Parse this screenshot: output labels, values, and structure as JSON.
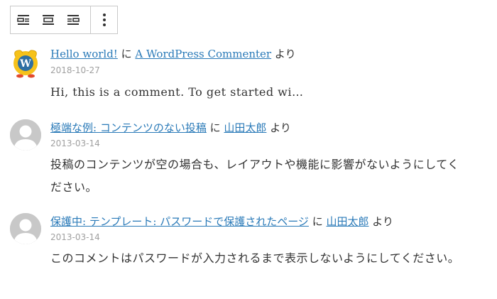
{
  "toolbar": {
    "buttons": [
      {
        "icon": "align-left-icon"
      },
      {
        "icon": "align-center-icon"
      },
      {
        "icon": "align-right-icon"
      }
    ],
    "more_icon": "more-vertical-icon"
  },
  "comments": [
    {
      "post_title": "Hello world!",
      "joiner": "に",
      "author": "A WordPress Commenter",
      "suffix": "より",
      "date": "2018-10-27",
      "excerpt": "Hi, this is a comment. To get started wi…"
    },
    {
      "post_title": "極端な例: コンテンツのない投稿",
      "joiner": "に",
      "author": "山田太郎",
      "suffix": "より",
      "date": "2013-03-14",
      "excerpt": "投稿のコンテンツが空の場合も、レイアウトや機能に影響がないようにしてください。"
    },
    {
      "post_title": "保護中: テンプレート: パスワードで保護されたページ",
      "joiner": "に",
      "author": "山田太郎",
      "suffix": "より",
      "date": "2013-03-14",
      "excerpt": "このコメントはパスワードが入力されるまで表示しないようにしてください。"
    }
  ],
  "colors": {
    "link": "#2a7ab8",
    "date": "#a0a0a0",
    "text": "#333333",
    "toolbar_border": "#c9c9c9"
  }
}
